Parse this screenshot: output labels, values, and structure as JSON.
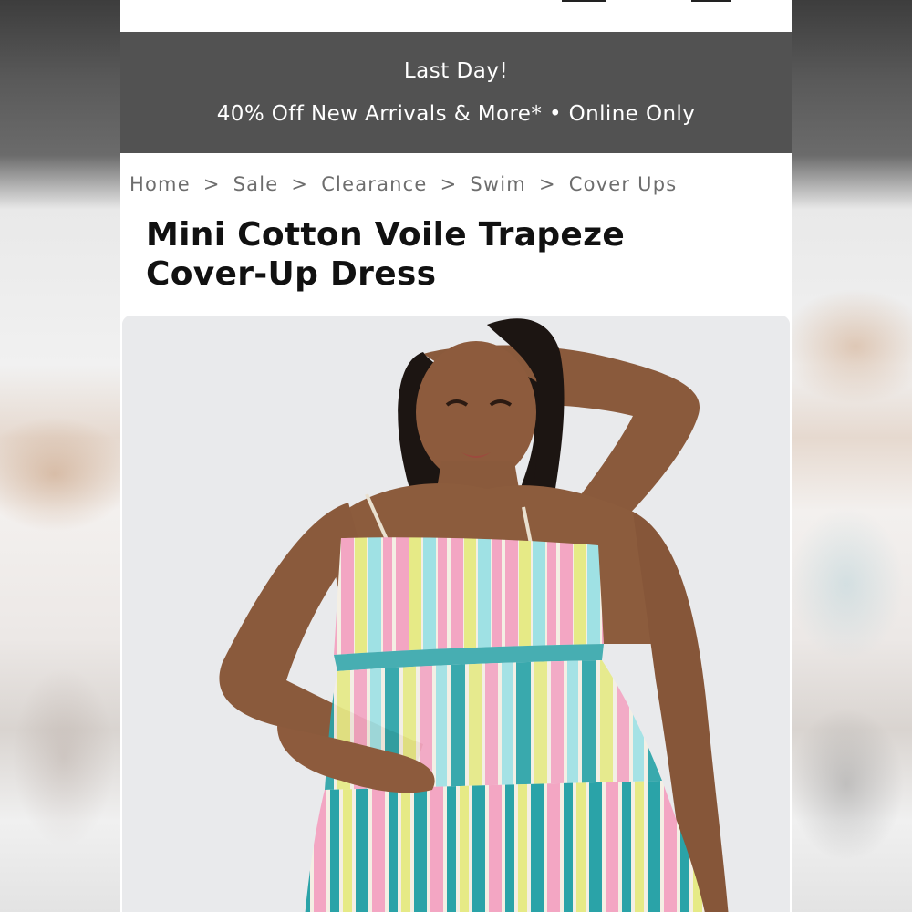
{
  "promo": {
    "title": "Last Day!",
    "subtitle": "40% Off New Arrivals & More* • Online Only"
  },
  "breadcrumb": {
    "items": [
      "Home",
      "Sale",
      "Clearance",
      "Swim",
      "Cover Ups"
    ],
    "separator": ">"
  },
  "product": {
    "title_line1": "Mini Cotton Voile Trapeze",
    "title_line2": "Cover-Up Dress",
    "image_alt_icon": "product-photo"
  },
  "colors": {
    "banner_bg": "#525252",
    "breadcrumb_text": "#6d6d6d",
    "title_text": "#111111",
    "stripe_teal": "#2aa3a8",
    "stripe_pink": "#f3a6c3",
    "stripe_yellow": "#e6ea86",
    "stripe_aqua": "#9fe1e4"
  }
}
